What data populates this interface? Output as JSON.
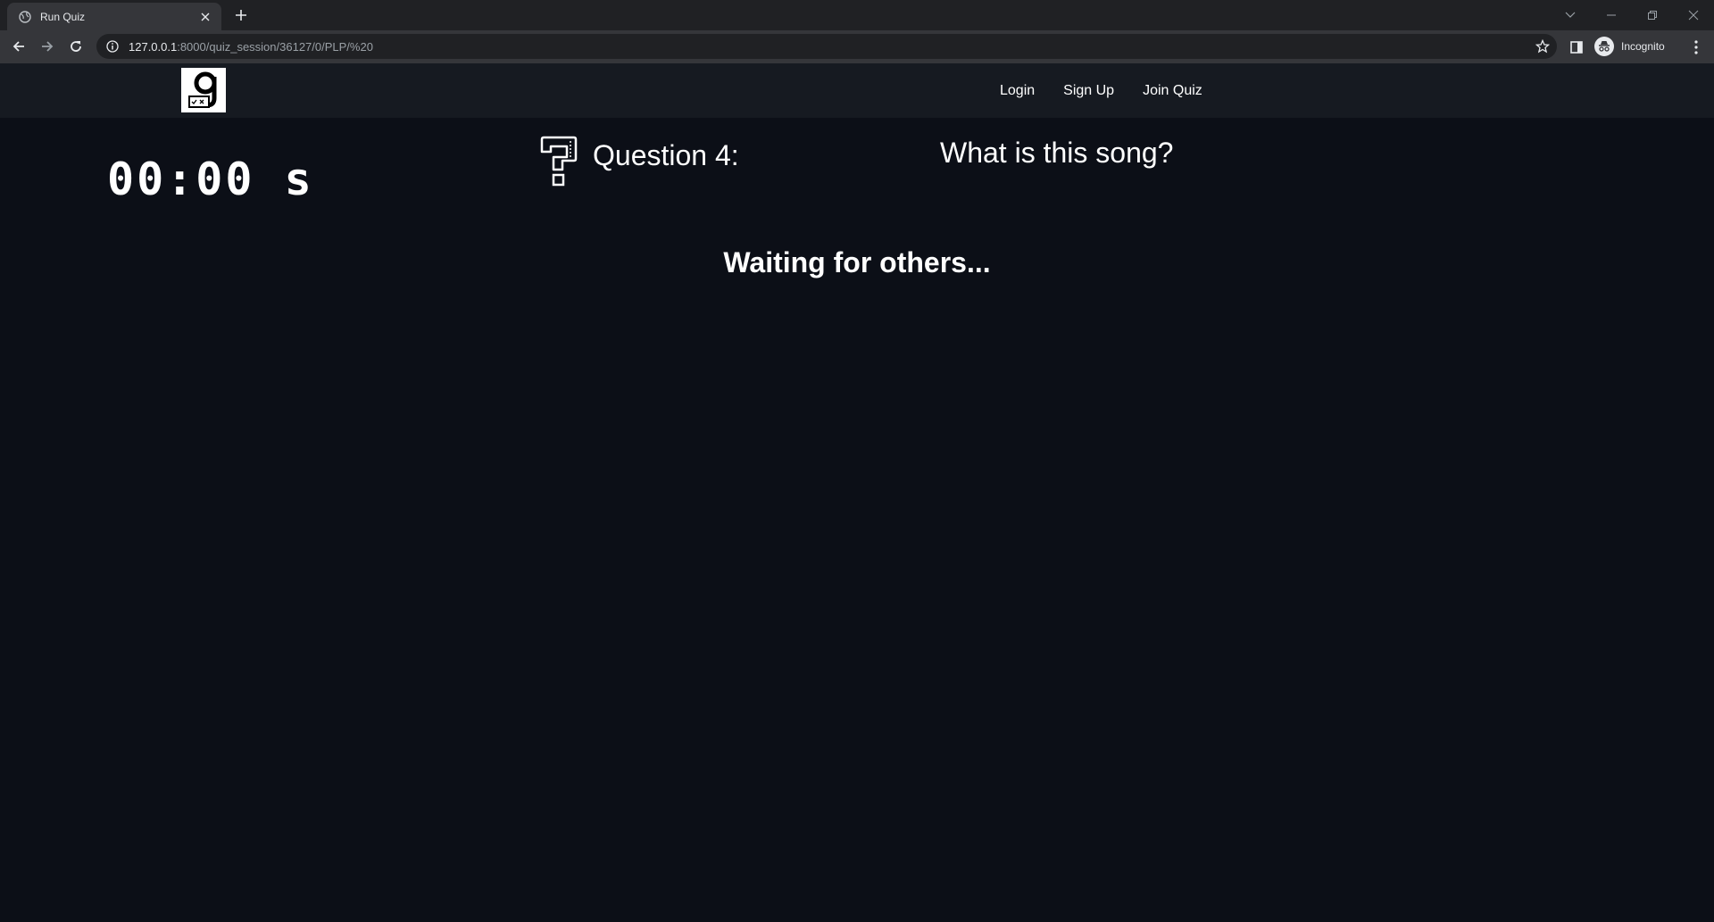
{
  "browser": {
    "tab_title": "Run Quiz",
    "url_host": "127.0.0.1",
    "url_rest": ":8000/quiz_session/36127/0/PLP/%20",
    "profile_label": "Incognito"
  },
  "site": {
    "nav_links": [
      "Login",
      "Sign Up",
      "Join Quiz"
    ]
  },
  "quiz": {
    "timer": "00:00 s",
    "question_label": "Question 4:",
    "question_text": "What is this song?",
    "status": "Waiting for others..."
  },
  "colors": {
    "page_bg": "#0c0f17",
    "navbar_bg": "#161a21",
    "text": "#ffffff"
  }
}
